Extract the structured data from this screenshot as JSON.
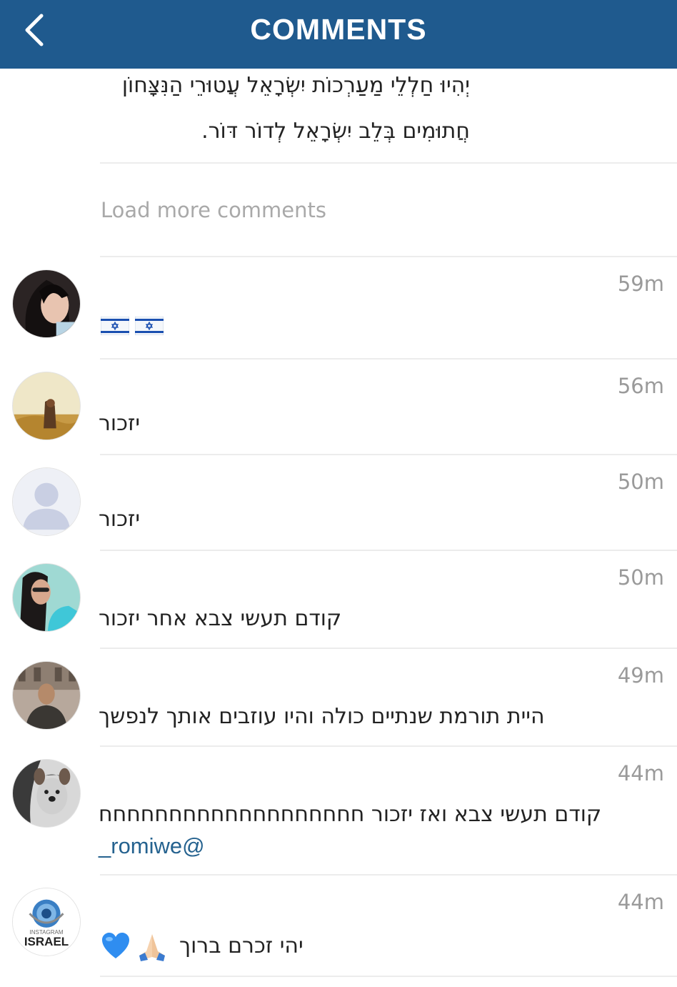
{
  "header": {
    "title": "COMMENTS"
  },
  "caption": {
    "line1": "יְהִיוּ חַלְלֵי מַעַרְכוֹת יִשְׂרָאֵל עֲטוּרֵי הַנִּצָּחוֹן",
    "line2": "חֲתוּמִים בְּלֵב יִשְׂרָאֵל לְדוֹר דּוֹר."
  },
  "load_more": "Load more comments",
  "comments": [
    {
      "time": "59m",
      "text": "",
      "emoji": [
        "israel-flag",
        "israel-flag"
      ]
    },
    {
      "time": "56m",
      "text": "יזכור"
    },
    {
      "time": "50m",
      "text": "יזכור"
    },
    {
      "time": "50m",
      "text": "קודם תעשי צבא אחר יזכור"
    },
    {
      "time": "49m",
      "text": "היית תורמת שנתיים כולה והיו עוזבים אותך לנפשך"
    },
    {
      "time": "44m",
      "text": "קודם תעשי צבא ואז יזכור חחחחחחחחחחחחחחחחחחח",
      "mention": "_romiwe@"
    },
    {
      "time": "44m",
      "text": "יהי זכרם ברוך",
      "emoji": [
        "praying-hands",
        "blue-heart"
      ]
    }
  ],
  "avatar_badge": {
    "line1": "INSTAGRAM",
    "line2": "ISRAEL"
  },
  "colors": {
    "header": "#1f5a8e",
    "mention": "#25628f",
    "muted": "#9a9a9a"
  }
}
